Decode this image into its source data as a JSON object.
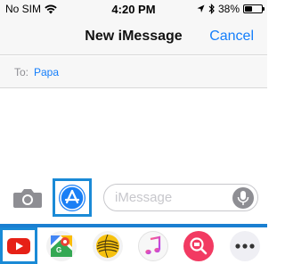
{
  "status_bar": {
    "carrier": "No SIM",
    "time": "4:20 PM",
    "battery": "38%",
    "battery_level": 0.38
  },
  "nav": {
    "title": "New iMessage",
    "cancel_label": "Cancel"
  },
  "to_field": {
    "label": "To:",
    "recipient": "Papa"
  },
  "compose": {
    "placeholder": "iMessage"
  },
  "app_drawer": {
    "apps": [
      {
        "name": "YouTube",
        "icon": "youtube-icon"
      },
      {
        "name": "Google Maps",
        "icon": "google-maps-icon"
      },
      {
        "name": "Globe app",
        "icon": "globe-icon"
      },
      {
        "name": "Music",
        "icon": "music-icon"
      },
      {
        "name": "Search images",
        "icon": "image-search-icon"
      },
      {
        "name": "More",
        "icon": "more-icon"
      }
    ]
  },
  "colors": {
    "accent": "#147efb",
    "highlight": "#1a8ad6"
  }
}
